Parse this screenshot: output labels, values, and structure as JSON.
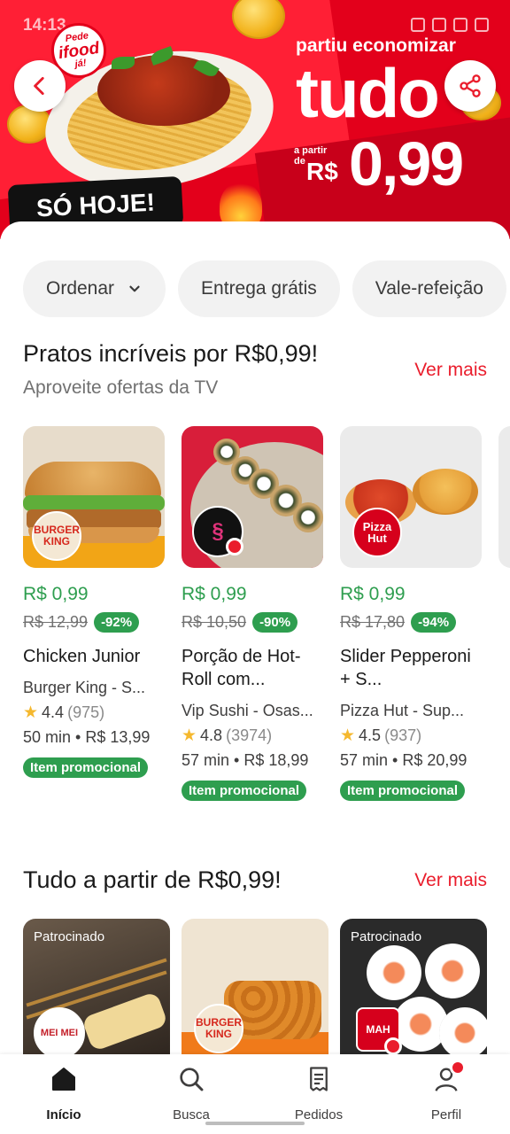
{
  "status": {
    "time": "14:13"
  },
  "banner": {
    "logo_line1": "Pede",
    "logo_line2": "ifood",
    "logo_line3": "já!",
    "tagline": "partiu economizar",
    "headline": "tudo",
    "from_label": "a partir de",
    "currency": "R$",
    "price": "0,99",
    "badge": "SÓ HOJE!"
  },
  "filters": [
    {
      "label": "Ordenar",
      "icon": "chevron-down-icon"
    },
    {
      "label": "Entrega grátis"
    },
    {
      "label": "Vale-refeição"
    }
  ],
  "section1": {
    "title": "Pratos incríveis por R$0,99!",
    "subtitle": "Aproveite ofertas da TV",
    "see_more": "Ver mais",
    "items": [
      {
        "price": "R$ 0,99",
        "old_price": "R$ 12,99",
        "discount": "-92%",
        "name": "Chicken Junior",
        "store": "Burger King - S...",
        "rating": "4.4",
        "reviews": "(975)",
        "meta": "50 min • R$ 13,99",
        "tag": "Item promocional",
        "brand": "BURGER KING"
      },
      {
        "price": "R$ 0,99",
        "old_price": "R$ 10,50",
        "discount": "-90%",
        "name": "Porção de Hot-Roll com...",
        "store": "Vip Sushi - Osas...",
        "rating": "4.8",
        "reviews": "(3974)",
        "meta": "57 min • R$ 18,99",
        "tag": "Item promocional",
        "brand": ""
      },
      {
        "price": "R$ 0,99",
        "old_price": "R$ 17,80",
        "discount": "-94%",
        "name": "Slider Pepperoni + S...",
        "store": "Pizza Hut - Sup...",
        "rating": "4.5",
        "reviews": "(937)",
        "meta": "57 min • R$ 20,99",
        "tag": "Item promocional",
        "brand": "Pizza Hut"
      }
    ]
  },
  "section2": {
    "title": "Tudo a partir de R$0,99!",
    "see_more": "Ver mais",
    "cards": [
      {
        "sponsored": "Patrocinado",
        "brand": "MEI MEI"
      },
      {
        "sponsored": "",
        "brand": "BURGER KING"
      },
      {
        "sponsored": "Patrocinado",
        "brand": "MAH"
      }
    ]
  },
  "nav": [
    {
      "label": "Início",
      "icon": "home-icon",
      "active": true
    },
    {
      "label": "Busca",
      "icon": "search-icon"
    },
    {
      "label": "Pedidos",
      "icon": "receipt-icon"
    },
    {
      "label": "Perfil",
      "icon": "profile-icon"
    }
  ],
  "colors": {
    "brand_red": "#ea1d2c",
    "promo_green": "#2e9e4f",
    "banner_red": "#e3001b"
  }
}
